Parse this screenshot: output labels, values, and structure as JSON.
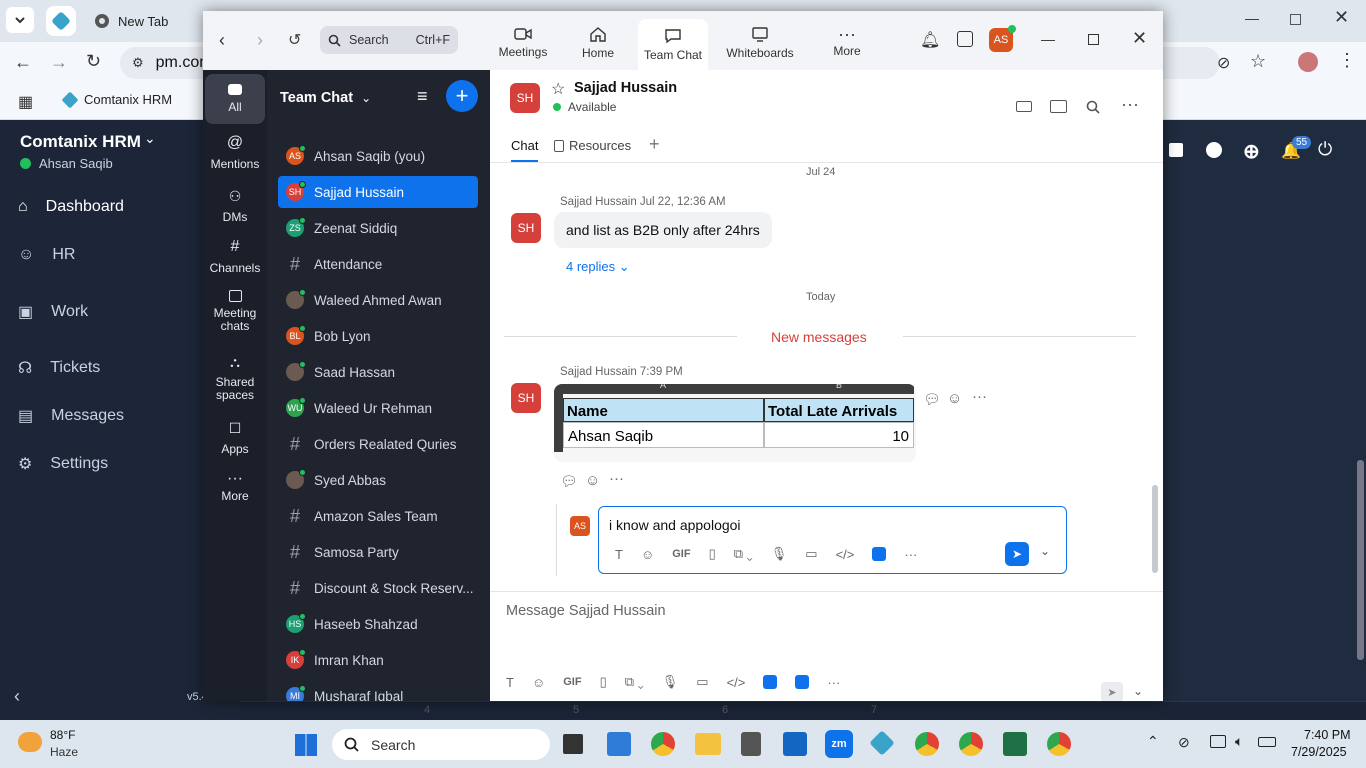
{
  "browser": {
    "tab_label": "New Tab",
    "address": "pm.com",
    "bookmark": "Comtanix HRM"
  },
  "hrm": {
    "brand": "Comtanix HRM",
    "user": "Ahsan Saqib",
    "nav": [
      "Dashboard",
      "HR",
      "Work",
      "Tickets",
      "Messages",
      "Settings"
    ],
    "version": "v5.4",
    "notif_count": "55",
    "axis_ticks": [
      "4",
      "5",
      "6",
      "7"
    ]
  },
  "zoom": {
    "search_placeholder": "Search",
    "search_shortcut": "Ctrl+F",
    "nav_tabs": [
      "Meetings",
      "Home",
      "Team Chat",
      "Whiteboards",
      "More"
    ],
    "user_initials": "AS",
    "rail": [
      "All",
      "Mentions",
      "DMs",
      "Channels",
      "Meeting chats",
      "Shared spaces",
      "Apps",
      "More"
    ],
    "list_title": "Team Chat",
    "channels": [
      {
        "name": "Ahsan Saqib (you)",
        "type": "avatar",
        "initials": "AS",
        "color": "#d9541e"
      },
      {
        "name": "Sajjad Hussain",
        "type": "avatar",
        "initials": "SH",
        "color": "#d6403b"
      },
      {
        "name": "Zeenat Siddiq",
        "type": "avatar",
        "initials": "ZS",
        "color": "#1f9e74"
      },
      {
        "name": "Attendance",
        "type": "channel"
      },
      {
        "name": "Waleed Ahmed Awan",
        "type": "photo"
      },
      {
        "name": "Bob Lyon",
        "type": "avatar",
        "initials": "BL",
        "color": "#d9541e"
      },
      {
        "name": "Saad Hassan",
        "type": "photo"
      },
      {
        "name": "Waleed Ur Rehman",
        "type": "avatar",
        "initials": "WU",
        "color": "#2fa24f"
      },
      {
        "name": "Orders Realated Quries",
        "type": "channel"
      },
      {
        "name": "Syed Abbas",
        "type": "photo"
      },
      {
        "name": "Amazon Sales Team",
        "type": "channel"
      },
      {
        "name": "Samosa Party",
        "type": "channel"
      },
      {
        "name": "Discount & Stock Reserv...",
        "type": "channel"
      },
      {
        "name": "Haseeb Shahzad",
        "type": "avatar",
        "initials": "HS",
        "color": "#1f9e74"
      },
      {
        "name": "Imran Khan",
        "type": "avatar",
        "initials": "IK",
        "color": "#d6403b"
      },
      {
        "name": "Musharaf Iqbal",
        "type": "avatar",
        "initials": "MI",
        "color": "#3a7bd5"
      }
    ],
    "chat": {
      "contact_name": "Sajjad Hussain",
      "contact_initials": "SH",
      "status": "Available",
      "tabs": [
        "Chat",
        "Resources"
      ],
      "date_jul": "Jul 24",
      "msg1_header": "Sajjad Hussain Jul 22, 12:36 AM",
      "msg1_text": "and list as B2B only after 24hrs",
      "replies": "4 replies",
      "date_today": "Today",
      "new_messages": "New messages",
      "msg2_header": "Sajjad Hussain 7:39 PM",
      "table_col_a": "A",
      "table_col_b": "B",
      "table_headers": [
        "Name",
        "Total Late Arrivals"
      ],
      "table_row": [
        "Ahsan Saqib",
        "10"
      ],
      "reply_initials": "AS",
      "reply_text": "i know and appologoi",
      "compose_placeholder": "Message Sajjad Hussain"
    }
  },
  "taskbar": {
    "temp": "88°F",
    "weather": "Haze",
    "search": "Search",
    "time": "7:40 PM",
    "date": "7/29/2025"
  }
}
